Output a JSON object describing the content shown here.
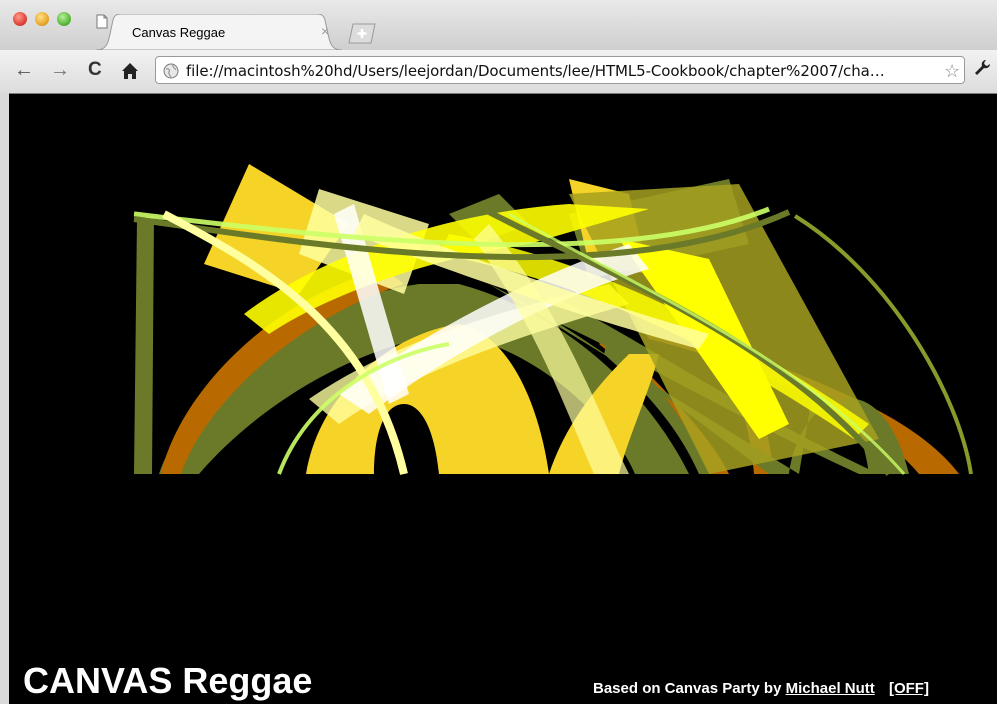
{
  "browser": {
    "tab_title": "Canvas Reggae",
    "tab_close": "×",
    "url": "file://macintosh%20hd/Users/leejordan/Documents/lee/HTML5-Cookbook/chapter%2007/cha…",
    "icons": [
      "back-arrow-icon",
      "forward-arrow-icon",
      "reload-icon",
      "home-icon",
      "globe-icon",
      "star-icon",
      "wrench-icon"
    ]
  },
  "page": {
    "title": "CANVAS Reggae",
    "credit_prefix": "Based on Canvas Party by",
    "author_link": "Michael Nutt",
    "toggle_link": "[OFF]"
  },
  "colors": {
    "background": "#000000",
    "palette": [
      "#6b7a28",
      "#b86a00",
      "#f5d327",
      "#ffff00",
      "#ffffa0",
      "#ffffff",
      "#ccff66"
    ]
  }
}
